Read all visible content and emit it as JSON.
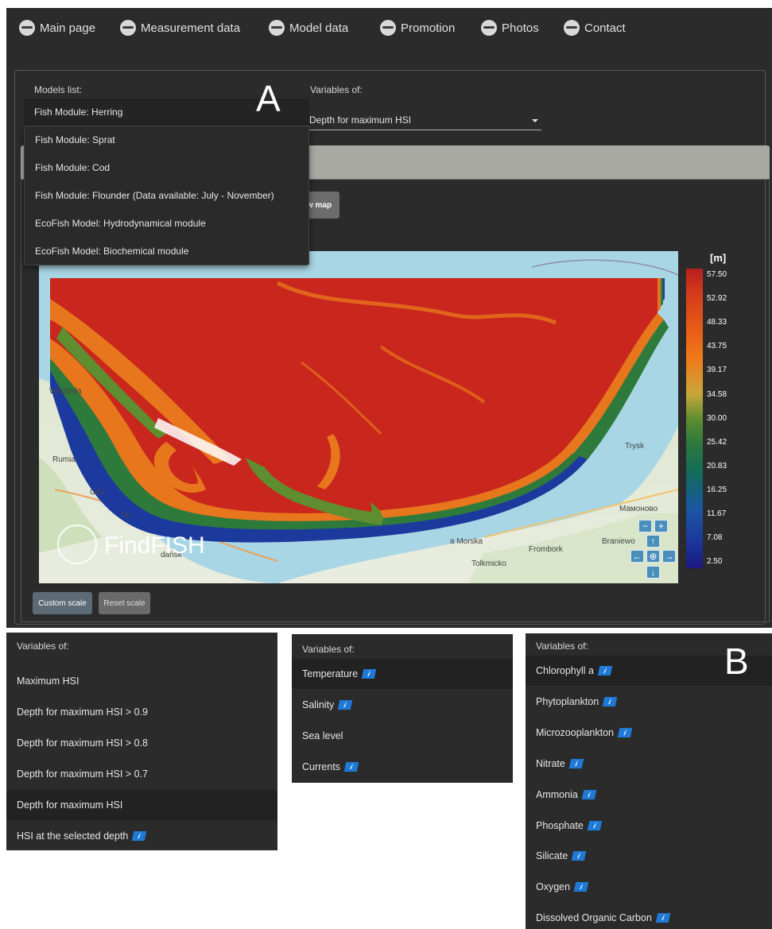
{
  "nav": {
    "items": [
      {
        "label": "Main page",
        "icon": "globe-icon"
      },
      {
        "label": "Measurement data",
        "icon": "globe-icon"
      },
      {
        "label": "Model data",
        "icon": "globe-icon"
      },
      {
        "label": "Promotion",
        "icon": "globe-icon"
      },
      {
        "label": "Photos",
        "icon": "globe-icon"
      },
      {
        "label": "Contact",
        "icon": "globe-icon"
      }
    ]
  },
  "selectors": {
    "models_label": "Models list:",
    "variables_label": "Variables of:",
    "selected_model": "Fish Module: Herring",
    "selected_variable": "Depth for maximum HSI",
    "model_options": [
      "Fish Module: Sprat",
      "Fish Module: Cod",
      "Fish Module: Flounder (Data available: July - November)",
      "EcoFish Model: Hydrodynamical module",
      "EcoFish Model: Biochemical module"
    ]
  },
  "annotations": {
    "a": "A",
    "b": "B"
  },
  "draw_map_button": "w map",
  "map": {
    "places": [
      "Władysła",
      "Rumia",
      "Gdy",
      "So",
      "Trysk",
      "Mамоново",
      "Braniewo",
      "Frombork",
      "Tolkmicko",
      "a Morska",
      "dańsk"
    ],
    "logo_text": "FindFISH",
    "colors": {
      "high": "#b81e1e",
      "mid": "#2e7a3b",
      "low": "#1b1880",
      "sea": "#a8d6e4"
    }
  },
  "colorbar": {
    "unit": "[m]",
    "ticks": [
      "57.50",
      "52.92",
      "48.33",
      "43.75",
      "39.17",
      "34.58",
      "30.00",
      "25.42",
      "20.83",
      "16.25",
      "11.67",
      "7.08",
      "2.50"
    ]
  },
  "scale_buttons": {
    "custom": "Custom scale",
    "reset": "Reset scale"
  },
  "panels": {
    "fish": {
      "header": "Variables of:",
      "rows": [
        {
          "label": "Maximum HSI",
          "info": false
        },
        {
          "label": "Depth for maximum HSI > 0.9",
          "info": false
        },
        {
          "label": "Depth for maximum HSI > 0.8",
          "info": false
        },
        {
          "label": "Depth for maximum HSI > 0.7",
          "info": false
        },
        {
          "label": "Depth for maximum HSI",
          "info": false
        },
        {
          "label": "HSI at the selected depth",
          "info": true
        }
      ]
    },
    "hydro": {
      "header": "Variables of:",
      "rows": [
        {
          "label": "Temperature",
          "info": true
        },
        {
          "label": "Salinity",
          "info": true
        },
        {
          "label": "Sea level",
          "info": false
        },
        {
          "label": "Currents",
          "info": true
        }
      ]
    },
    "bio": {
      "header": "Variables of:",
      "rows": [
        {
          "label": "Chlorophyll a",
          "info": true
        },
        {
          "label": "Phytoplankton",
          "info": true
        },
        {
          "label": "Microzooplankton",
          "info": true
        },
        {
          "label": "Nitrate",
          "info": true
        },
        {
          "label": "Ammonia",
          "info": true
        },
        {
          "label": "Phosphate",
          "info": true
        },
        {
          "label": "Silicate",
          "info": true
        },
        {
          "label": "Oxygen",
          "info": true
        },
        {
          "label": "Dissolved Organic Carbon",
          "info": true
        }
      ]
    }
  },
  "info_glyph": "i"
}
